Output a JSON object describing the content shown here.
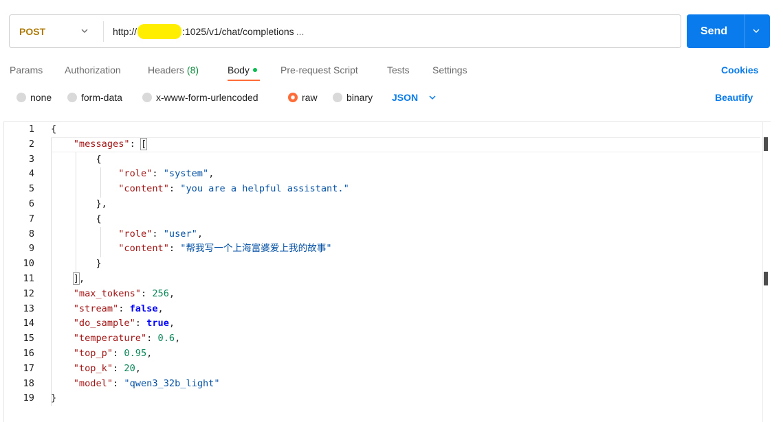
{
  "request": {
    "method": "POST",
    "url_prefix": "http://",
    "url_suffix": ":1025/v1/chat/completions",
    "url_ellipsis": "...",
    "send_label": "Send"
  },
  "tabs": [
    {
      "label": "Params"
    },
    {
      "label": "Authorization"
    },
    {
      "label": "Headers",
      "count": "(8)"
    },
    {
      "label": "Body"
    },
    {
      "label": "Pre-request Script"
    },
    {
      "label": "Tests"
    },
    {
      "label": "Settings"
    }
  ],
  "cookies_label": "Cookies",
  "body_options": [
    {
      "label": "none",
      "selected": false
    },
    {
      "label": "form-data",
      "selected": false
    },
    {
      "label": "x-www-form-urlencoded",
      "selected": false
    },
    {
      "label": "raw",
      "selected": true
    },
    {
      "label": "binary",
      "selected": false
    }
  ],
  "language": "JSON",
  "beautify_label": "Beautify",
  "editor": {
    "line_numbers": [
      "1",
      "2",
      "3",
      "4",
      "5",
      "6",
      "7",
      "8",
      "9",
      "10",
      "11",
      "12",
      "13",
      "14",
      "15",
      "16",
      "17",
      "18",
      "19"
    ],
    "tokens": {
      "messages_key": "\"messages\"",
      "role_key": "\"role\"",
      "content_key": "\"content\"",
      "system_val": "\"system\"",
      "system_content": "\"you are a helpful assistant.\"",
      "user_val": "\"user\"",
      "user_content": "\"帮我写一个上海富婆爱上我的故事\"",
      "max_tokens_key": "\"max_tokens\"",
      "max_tokens_val": "256",
      "stream_key": "\"stream\"",
      "stream_val": "false",
      "do_sample_key": "\"do_sample\"",
      "do_sample_val": "true",
      "temperature_key": "\"temperature\"",
      "temperature_val": "0.6",
      "top_p_key": "\"top_p\"",
      "top_p_val": "0.95",
      "top_k_key": "\"top_k\"",
      "top_k_val": "20",
      "model_key": "\"model\"",
      "model_val": "\"qwen3_32b_light\""
    }
  },
  "colors": {
    "method": "#ad7a03",
    "send_bg": "#097bed",
    "accent": "#ff6c37",
    "link": "#097bed",
    "json_key": "#a31515",
    "json_string": "#0451a5",
    "json_number": "#098658",
    "json_boolean": "#0000ff",
    "headers_count": "#0c8a3c",
    "body_dot": "#0cbb52"
  },
  "icons": [
    "chevron-down-icon",
    "redaction-mark",
    "status-dot-icon"
  ]
}
